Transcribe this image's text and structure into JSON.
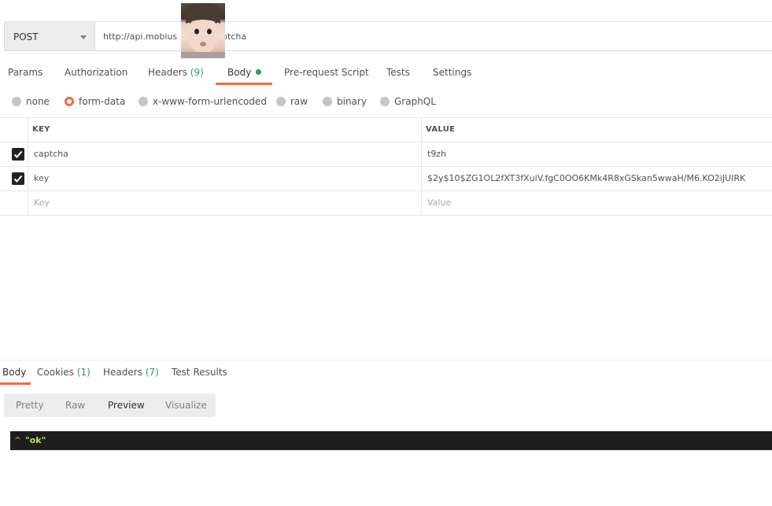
{
  "request": {
    "method": "POST",
    "url": "http://api.mobius                 i/captcha"
  },
  "request_tabs": {
    "params": "Params",
    "authorization": "Authorization",
    "headers": "Headers",
    "headers_count": "(9)",
    "body": "Body",
    "pre_request": "Pre-request Script",
    "tests": "Tests",
    "settings": "Settings"
  },
  "body_types": {
    "none": "none",
    "form_data": "form-data",
    "urlencoded": "x-www-form-urlencoded",
    "raw": "raw",
    "binary": "binary",
    "graphql": "GraphQL",
    "selected": "form-data"
  },
  "table": {
    "key_header": "KEY",
    "value_header": "VALUE",
    "rows": [
      {
        "key": "captcha",
        "value": "t9zh",
        "checked": true
      },
      {
        "key": "key",
        "value": "$2y$10$ZG1OL2fXT3fXuiV.fgC0OO6KMk4R8xGSkan5wwaH/M6.KO2iJUIRK",
        "checked": true
      }
    ],
    "key_placeholder": "Key",
    "value_placeholder": "Value"
  },
  "response_tabs": {
    "body": "Body",
    "cookies": "Cookies",
    "cookies_count": "(1)",
    "headers": "Headers",
    "headers_count": "(7)",
    "test_results": "Test Results"
  },
  "format_buttons": {
    "pretty": "Pretty",
    "raw": "Raw",
    "preview": "Preview",
    "visualize": "Visualize",
    "selected": "Preview"
  },
  "response_body": {
    "caret": "^",
    "value": "\"ok\""
  },
  "colors": {
    "accent": "#f26b3a",
    "green": "#26a04a",
    "code_bg": "#1e1e1e",
    "code_text": "#b5e853"
  },
  "icons": {
    "method_dropdown": "chevron-down-icon",
    "checkbox": "checkmark-icon",
    "body_indicator": "dot-icon"
  }
}
